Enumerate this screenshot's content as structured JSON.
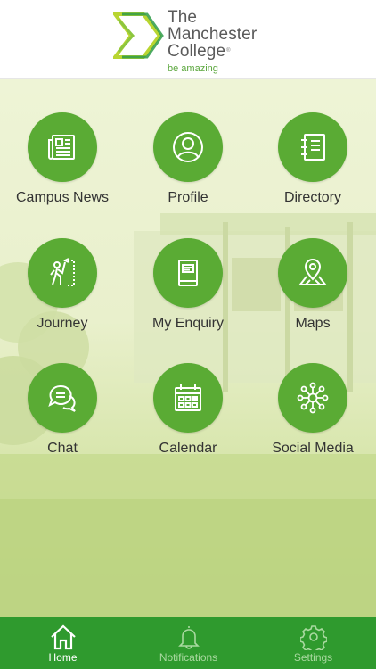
{
  "header": {
    "logo_line1": "The",
    "logo_line2": "Manchester",
    "logo_line3": "College",
    "tagline": "be amazing"
  },
  "tiles": [
    {
      "label": "Campus News",
      "icon": "newspaper-icon"
    },
    {
      "label": "Profile",
      "icon": "user-icon"
    },
    {
      "label": "Directory",
      "icon": "address-book-icon"
    },
    {
      "label": "Journey",
      "icon": "journey-icon"
    },
    {
      "label": "My Enquiry",
      "icon": "book-icon"
    },
    {
      "label": "Maps",
      "icon": "map-pin-icon"
    },
    {
      "label": "Chat",
      "icon": "chat-bubbles-icon"
    },
    {
      "label": "Calendar",
      "icon": "calendar-icon"
    },
    {
      "label": "Social Media",
      "icon": "network-icon"
    }
  ],
  "tabbar": {
    "items": [
      {
        "label": "Home",
        "icon": "home-icon",
        "active": true
      },
      {
        "label": "Notifications",
        "icon": "bell-icon",
        "active": false
      },
      {
        "label": "Settings",
        "icon": "gear-icon",
        "active": false
      }
    ]
  },
  "colors": {
    "accent": "#5aab34",
    "tabbar": "#2f9a2e",
    "background": "#eef4d6"
  }
}
